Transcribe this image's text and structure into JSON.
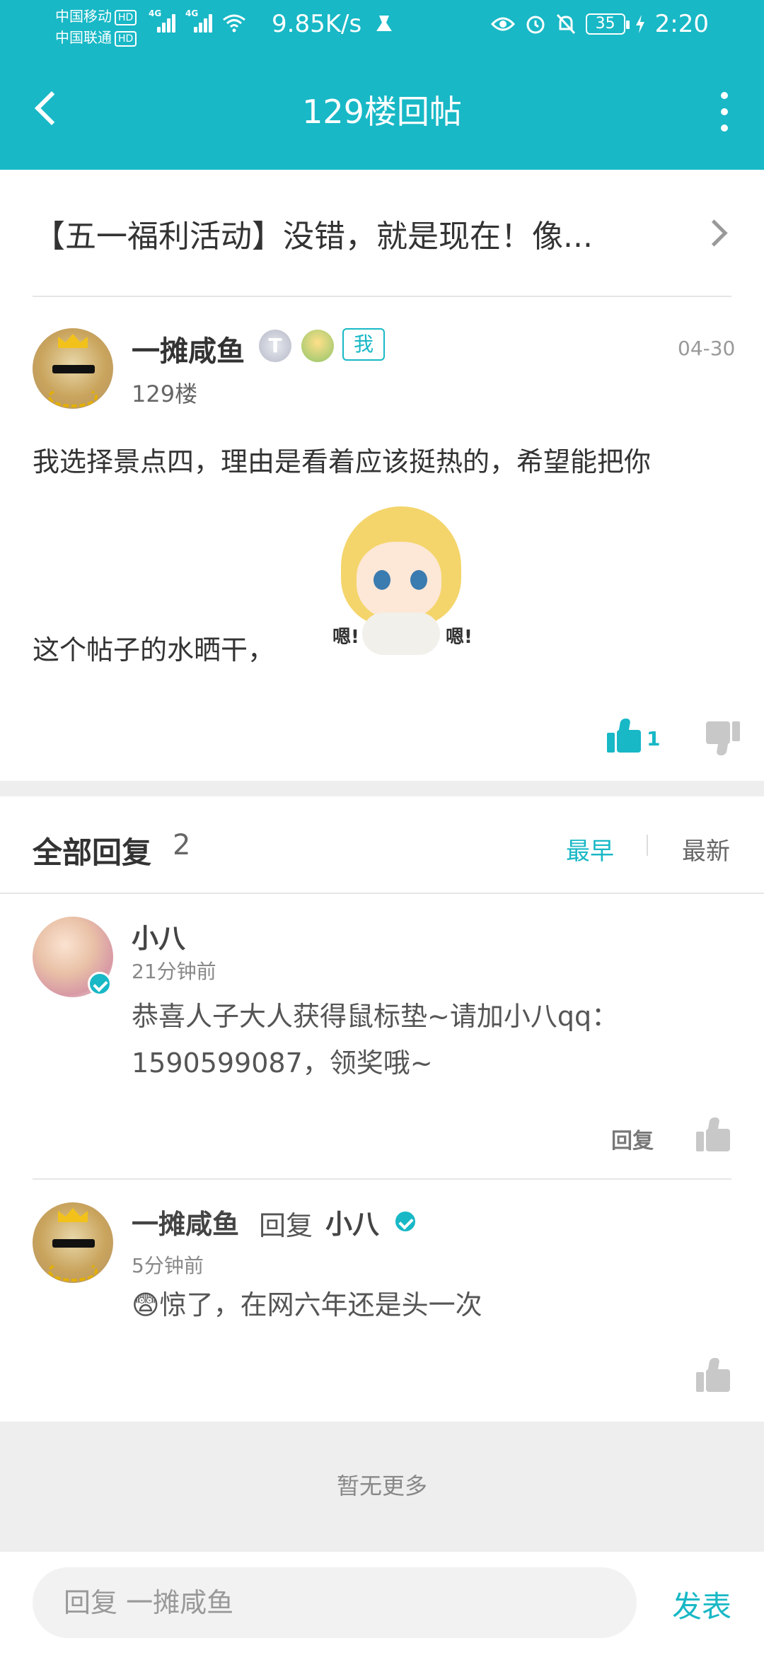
{
  "status": {
    "carrier1": "中国移动",
    "carrier2": "中国联通",
    "hd": "HD",
    "net1": "4G",
    "net2": "4G",
    "speed": "9.85K/s",
    "battery": "35",
    "time": "2:20"
  },
  "appbar": {
    "title": "129楼回帖"
  },
  "thread": {
    "title": "【五一福利活动】没错，就是现在！像..."
  },
  "post": {
    "author": "一摊咸鱼",
    "level_badge": "T",
    "me_tag": "我",
    "floor": "129楼",
    "date": "04-30",
    "text_line1": "我选择景点四，理由是看着应该挺热的，希望能把你",
    "text_line2": "这个帖子的水晒干，",
    "sticker_text": "嗯!",
    "likes": "1"
  },
  "replies": {
    "title": "全部回复",
    "count": "2",
    "sort_earliest": "最早",
    "sort_latest": "最新",
    "items": [
      {
        "name": "小八",
        "time": "21分钟前",
        "text": "恭喜人子大人获得鼠标垫~请加小八qq：1590599087，领奖哦~",
        "action": "回复"
      },
      {
        "name": "一摊咸鱼",
        "reply_word": "回复",
        "reply_to": "小八",
        "time": "5分钟前",
        "text": "😨惊了，在网六年还是头一次"
      }
    ]
  },
  "footer": {
    "no_more": "暂无更多",
    "input_placeholder": "回复 一摊咸鱼",
    "send": "发表"
  },
  "colors": {
    "accent": "#18b8c6"
  }
}
